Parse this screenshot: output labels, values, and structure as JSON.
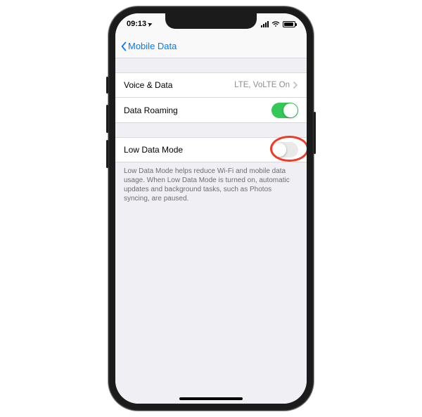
{
  "status": {
    "time": "09:13",
    "location_arrow": "➤"
  },
  "nav": {
    "back_label": "Mobile Data"
  },
  "group1": {
    "voice_data": {
      "label": "Voice & Data",
      "value": "LTE, VoLTE On"
    },
    "data_roaming": {
      "label": "Data Roaming",
      "on": true
    }
  },
  "group2": {
    "low_data_mode": {
      "label": "Low Data Mode",
      "on": false
    },
    "footer": "Low Data Mode helps reduce Wi-Fi and mobile data usage. When Low Data Mode is turned on, automatic updates and background tasks, such as Photos syncing, are paused."
  }
}
